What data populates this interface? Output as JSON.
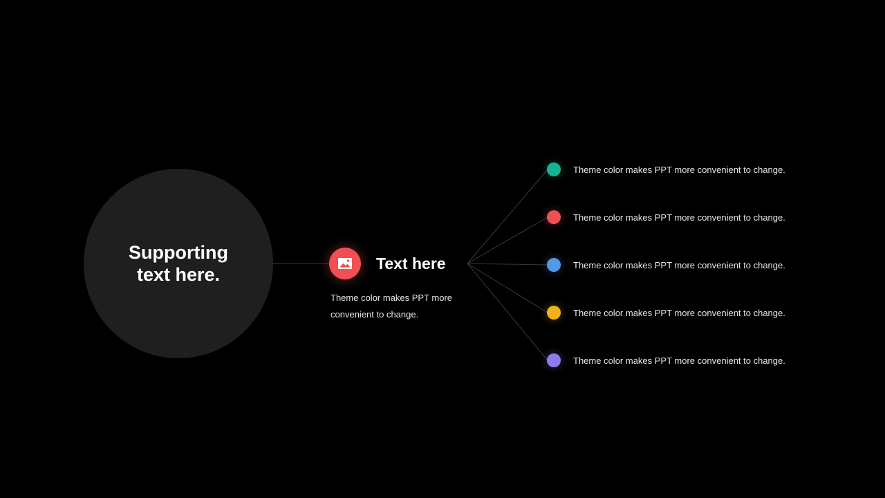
{
  "main_circle": {
    "text": "Supporting\ntext here."
  },
  "center": {
    "icon": "image-icon",
    "icon_color": "#f05053",
    "title": "Text here",
    "description": "Theme color makes PPT more convenient to change."
  },
  "items": [
    {
      "color": "#13b591",
      "text": "Theme color makes PPT more convenient to change."
    },
    {
      "color": "#f05053",
      "text": "Theme color makes PPT more convenient to change."
    },
    {
      "color": "#5598e6",
      "text": "Theme color makes PPT more convenient to change."
    },
    {
      "color": "#f2b21d",
      "text": "Theme color makes PPT more convenient to change."
    },
    {
      "color": "#8f7cec",
      "text": "Theme color makes PPT more convenient to change."
    }
  ]
}
